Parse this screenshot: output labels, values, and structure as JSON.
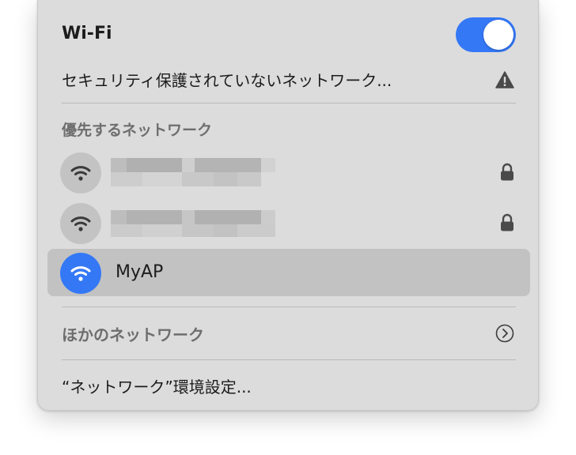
{
  "menu": {
    "title": "Wi-Fi",
    "wifi_enabled": true,
    "accent_color": "#3478f6",
    "unsecured_networks_label": "セキュリティ保護されていないネットワーク...",
    "preferred_networks_header": "優先するネットワーク",
    "networks": [
      {
        "name": "",
        "secured": true,
        "connected": false,
        "name_obscured": true
      },
      {
        "name": "",
        "secured": true,
        "connected": false,
        "name_obscured": true
      },
      {
        "name": "MyAP",
        "secured": false,
        "connected": true,
        "name_obscured": false
      }
    ],
    "other_networks_label": "ほかのネットワーク",
    "network_settings_label": "“ネットワーク”環境設定..."
  },
  "icons": {
    "warning": "warning-triangle-icon",
    "wifi": "wifi-icon",
    "lock": "lock-icon",
    "chevron": "chevron-right-circle-icon"
  }
}
